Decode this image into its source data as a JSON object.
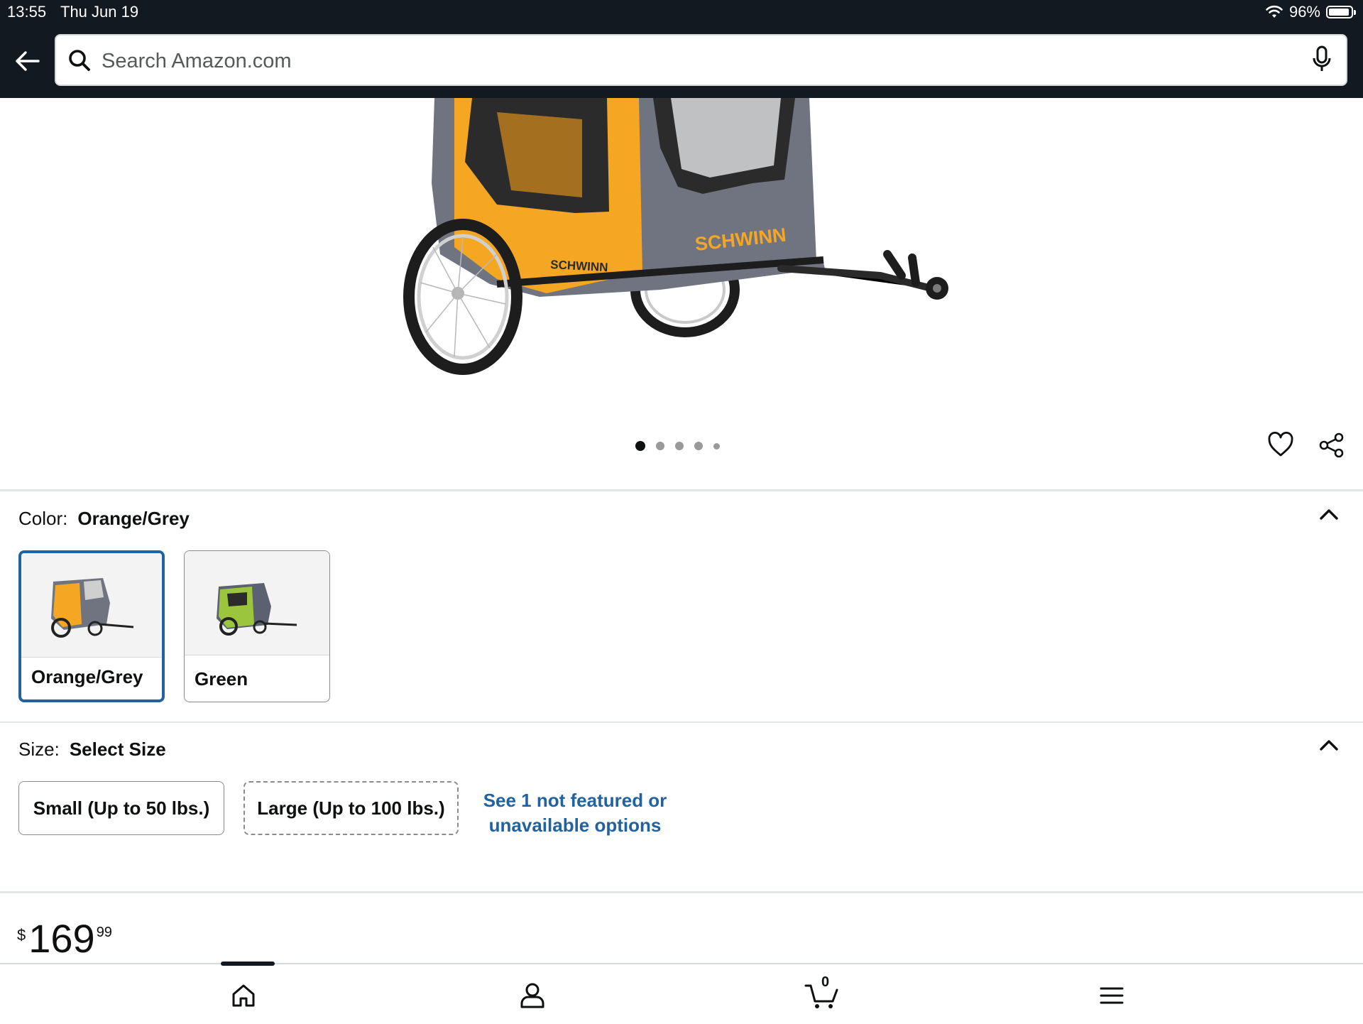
{
  "status": {
    "time": "13:55",
    "date": "Thu Jun 19",
    "battery": "96%"
  },
  "search": {
    "placeholder": "Search Amazon.com"
  },
  "hero": {
    "brand_text": "SCHWINN",
    "image_count": 5,
    "active_image": 1
  },
  "color": {
    "label": "Color:",
    "selected": "Orange/Grey",
    "options": [
      {
        "name": "Orange/Grey",
        "body": "#f5a623",
        "panel": "#6f7480"
      },
      {
        "name": "Green",
        "body": "#9bc53d",
        "panel": "#5b6170"
      }
    ]
  },
  "size": {
    "label": "Size:",
    "selected": "Select Size",
    "options": [
      "Small (Up to 50 lbs.)",
      "Large (Up to 100 lbs.)"
    ],
    "more_link": "See 1 not featured or unavailable options"
  },
  "price": {
    "symbol": "$",
    "whole": "169",
    "fraction": "99"
  },
  "nav": {
    "cart_count": "0",
    "items": [
      "home-icon",
      "account-icon",
      "cart-icon",
      "menu-icon"
    ]
  },
  "colors": {
    "header": "#131921",
    "link": "#2162a1",
    "selected_border": "#2162a1"
  }
}
